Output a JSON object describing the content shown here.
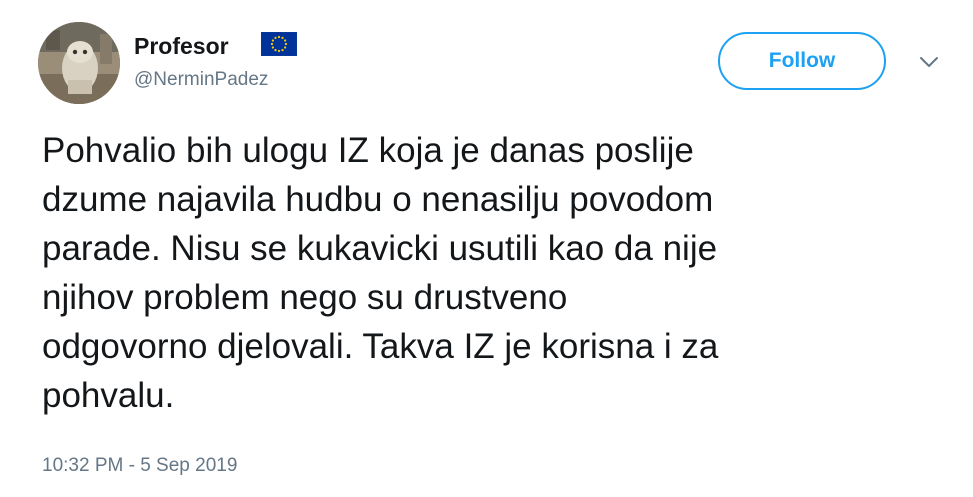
{
  "user": {
    "display_name": "Profesor",
    "handle": "@NerminPadez",
    "flag_icon": "eu-flag-icon",
    "avatar": "statue-photo"
  },
  "actions": {
    "follow_label": "Follow",
    "menu_icon": "chevron-down-icon"
  },
  "tweet": {
    "text": "Pohvalio bih ulogu IZ koja je danas poslije\ndzume najavila hudbu o nenasilju povodom\nparade. Nisu se kukavicki usutili kao da nije\nnjihov problem nego su drustveno\nodgovorno djelovali. Takva IZ je korisna i za\npohvalu.",
    "timestamp": "10:32 PM - 5 Sep 2019"
  },
  "colors": {
    "accent": "#1da1f2",
    "text": "#14171a",
    "muted": "#657786",
    "eu_blue": "#003399",
    "eu_gold": "#ffcc00"
  }
}
